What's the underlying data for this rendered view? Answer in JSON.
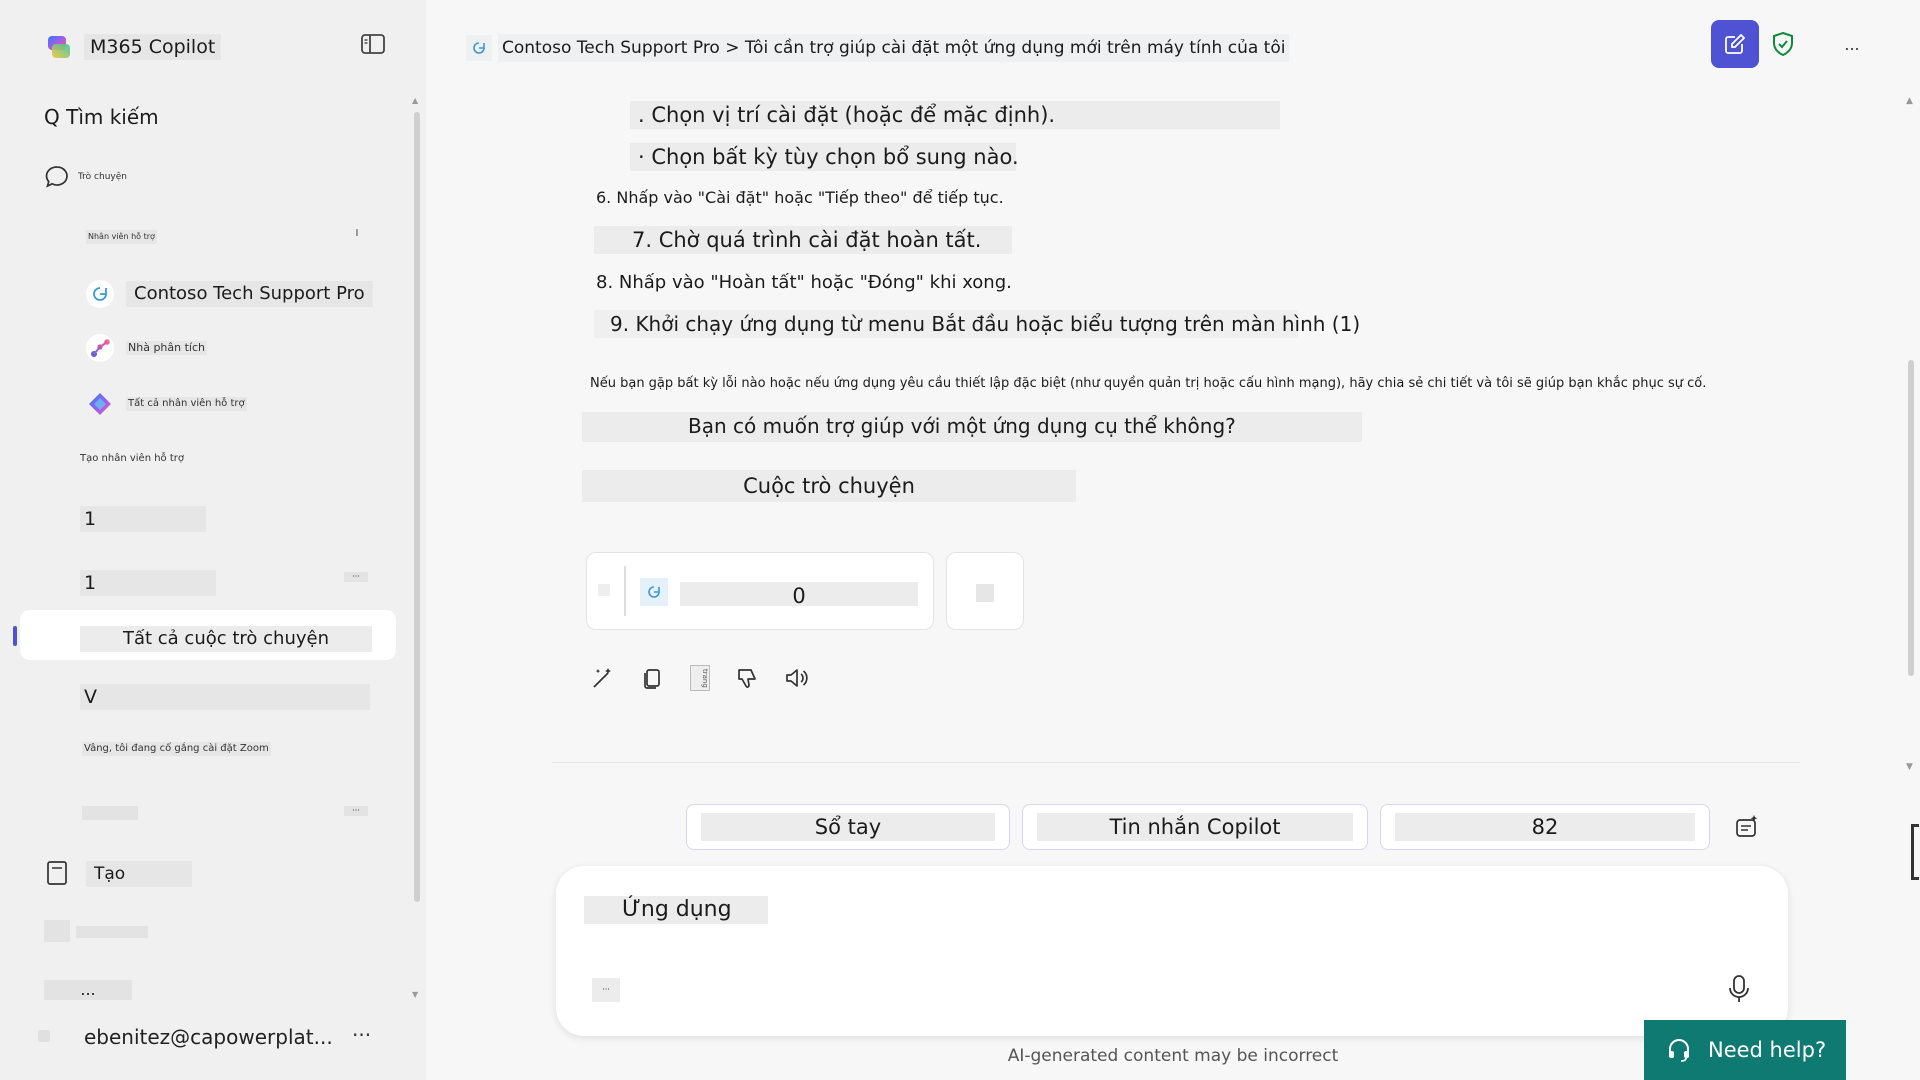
{
  "sidebar": {
    "app_title": "M365 Copilot",
    "search_label": "Q Tìm kiếm",
    "chat_label": "Trò chuyện",
    "agents_header": "Nhân viên hỗ trợ",
    "agents": [
      {
        "label": "Contoso Tech Support Pro"
      },
      {
        "label": "Nhà phân tích"
      },
      {
        "label": "Tất cả nhân viên hỗ trợ"
      }
    ],
    "create_agent": "Tạo nhân viên hỗ trợ",
    "item_1": "1",
    "item_2": "1",
    "all_chats": "Tất cả cuộc trò chuyện",
    "item_v": "V",
    "recent_chat": "Vâng, tôi đang cố gắng cài đặt Zoom",
    "create": "Tạo",
    "more": "...",
    "user_email": "ebenitez@capowerplat...",
    "user_more": "···"
  },
  "header": {
    "breadcrumb": "Contoso Tech Support Pro > Tôi cần trợ giúp cài đặt một ứng dụng mới trên máy tính của tôi",
    "more": "..."
  },
  "conversation": {
    "lines": [
      ". Chọn vị trí cài đặt (hoặc để mặc định).",
      "· Chọn bất kỳ tùy chọn bổ sung nào.",
      "6. Nhấp vào \"Cài đặt\" hoặc \"Tiếp theo\" để tiếp tục.",
      "7. Chờ quá trình cài đặt hoàn tất.",
      "8. Nhấp vào \"Hoàn tất\" hoặc \"Đóng\" khi xong.",
      "9. Khởi chạy ứng dụng từ menu Bắt đầu hoặc biểu tượng trên màn hình (1)"
    ],
    "note": "Nếu bạn gặp bất kỳ lỗi nào hoặc nếu ứng dụng yêu cầu thiết lập đặc biệt (như quyền quản trị hoặc cấu hình mạng), hãy chia sẻ chi tiết và tôi sẽ giúp bạn khắc phục sự cố.",
    "question": "Bạn có muốn trợ giúp với một ứng dụng cụ thể không?",
    "conversation_label": "Cuộc trò chuyện",
    "citation_count": "0",
    "action_mid_label": "trang"
  },
  "suggestions": [
    "Sổ tay",
    "Tin nhắn Copilot",
    "82"
  ],
  "composer": {
    "input_text": "Ứng dụng"
  },
  "footer": {
    "disclaimer": "AI-generated content may be incorrect",
    "need_help": "Need help?"
  },
  "colors": {
    "accent": "#4f52d2",
    "need_help_bg": "#0e7a72",
    "shield": "#0e8a3b"
  }
}
